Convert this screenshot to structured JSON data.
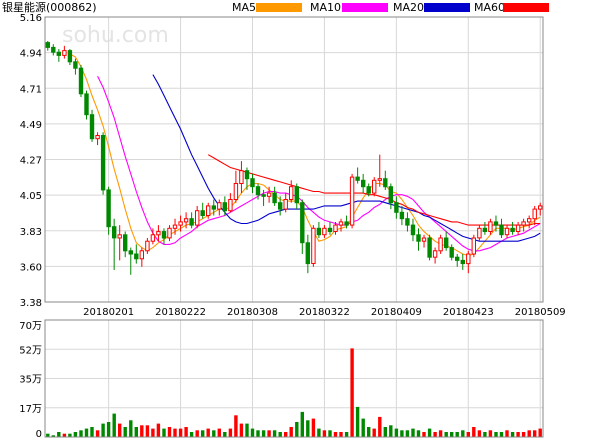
{
  "header": {
    "title": "银星能源(000862)",
    "ma_legend": [
      {
        "label": "MA5",
        "color": "#ff9900"
      },
      {
        "label": "MA10",
        "color": "#ff00ff"
      },
      {
        "label": "MA20",
        "color": "#0000cc"
      },
      {
        "label": "MA60",
        "color": "#ff0000"
      }
    ]
  },
  "watermark": "sohu.com",
  "colors": {
    "up": "#ff0000",
    "down": "#008800",
    "grid": "#d8d8d8",
    "frame": "#888888"
  },
  "chart_data": [
    {
      "type": "candlestick",
      "title": "银星能源(000862)",
      "ylim": [
        3.38,
        5.16
      ],
      "y_ticks": [
        "5.16",
        "4.94",
        "4.71",
        "4.49",
        "4.27",
        "4.05",
        "3.83",
        "3.60",
        "3.38"
      ],
      "x_ticks": [
        "20180201",
        "20180222",
        "20180308",
        "20180322",
        "20180409",
        "20180423",
        "20180509"
      ],
      "x_tick_index": [
        11,
        24,
        37,
        50,
        63,
        76,
        89
      ],
      "ohlc": [
        [
          5.0,
          5.01,
          4.95,
          4.97
        ],
        [
          4.97,
          4.99,
          4.92,
          4.94
        ],
        [
          4.94,
          4.96,
          4.88,
          4.92
        ],
        [
          4.92,
          4.98,
          4.9,
          4.95
        ],
        [
          4.95,
          4.96,
          4.86,
          4.88
        ],
        [
          4.88,
          4.9,
          4.8,
          4.84
        ],
        [
          4.84,
          4.86,
          4.66,
          4.68
        ],
        [
          4.68,
          4.7,
          4.52,
          4.55
        ],
        [
          4.55,
          4.58,
          4.38,
          4.4
        ],
        [
          4.4,
          4.44,
          4.36,
          4.42
        ],
        [
          4.42,
          4.44,
          4.05,
          4.08
        ],
        [
          4.08,
          4.1,
          3.8,
          3.85
        ],
        [
          3.85,
          3.9,
          3.58,
          3.78
        ],
        [
          3.78,
          3.86,
          3.64,
          3.8
        ],
        [
          3.8,
          3.82,
          3.66,
          3.7
        ],
        [
          3.7,
          3.72,
          3.55,
          3.68
        ],
        [
          3.68,
          3.74,
          3.62,
          3.65
        ],
        [
          3.65,
          3.72,
          3.6,
          3.7
        ],
        [
          3.7,
          3.78,
          3.68,
          3.76
        ],
        [
          3.76,
          3.84,
          3.74,
          3.8
        ],
        [
          3.8,
          3.86,
          3.76,
          3.82
        ],
        [
          3.82,
          3.84,
          3.74,
          3.78
        ],
        [
          3.78,
          3.86,
          3.76,
          3.84
        ],
        [
          3.84,
          3.9,
          3.8,
          3.86
        ],
        [
          3.86,
          3.92,
          3.82,
          3.88
        ],
        [
          3.88,
          3.94,
          3.84,
          3.9
        ],
        [
          3.9,
          3.94,
          3.84,
          3.86
        ],
        [
          3.86,
          3.98,
          3.84,
          3.95
        ],
        [
          3.95,
          4.0,
          3.9,
          3.92
        ],
        [
          3.92,
          4.0,
          3.9,
          3.98
        ],
        [
          3.98,
          4.02,
          3.92,
          3.96
        ],
        [
          3.96,
          4.02,
          3.92,
          4.0
        ],
        [
          4.0,
          4.04,
          3.92,
          3.95
        ],
        [
          3.95,
          4.06,
          3.94,
          4.02
        ],
        [
          4.02,
          4.2,
          4.0,
          4.12
        ],
        [
          4.12,
          4.26,
          4.06,
          4.2
        ],
        [
          4.2,
          4.22,
          4.08,
          4.15
        ],
        [
          4.15,
          4.18,
          4.06,
          4.1
        ],
        [
          4.1,
          4.12,
          4.02,
          4.05
        ],
        [
          4.05,
          4.08,
          3.98,
          4.04
        ],
        [
          4.04,
          4.1,
          4.0,
          4.06
        ],
        [
          4.06,
          4.1,
          3.98,
          4.0
        ],
        [
          4.0,
          4.04,
          3.92,
          3.96
        ],
        [
          3.96,
          4.06,
          3.94,
          4.02
        ],
        [
          4.02,
          4.14,
          4.0,
          4.1
        ],
        [
          4.1,
          4.12,
          3.96,
          4.0
        ],
        [
          4.0,
          4.02,
          3.68,
          3.75
        ],
        [
          3.75,
          3.8,
          3.56,
          3.62
        ],
        [
          3.62,
          3.86,
          3.6,
          3.84
        ],
        [
          3.84,
          3.88,
          3.78,
          3.8
        ],
        [
          3.8,
          3.86,
          3.78,
          3.84
        ],
        [
          3.84,
          3.88,
          3.8,
          3.82
        ],
        [
          3.82,
          3.88,
          3.8,
          3.86
        ],
        [
          3.86,
          3.9,
          3.82,
          3.88
        ],
        [
          3.88,
          3.92,
          3.84,
          3.86
        ],
        [
          3.86,
          4.18,
          3.84,
          4.16
        ],
        [
          4.16,
          4.22,
          4.12,
          4.14
        ],
        [
          4.14,
          4.18,
          4.06,
          4.1
        ],
        [
          4.1,
          4.12,
          4.04,
          4.06
        ],
        [
          4.06,
          4.16,
          4.04,
          4.14
        ],
        [
          4.14,
          4.3,
          4.1,
          4.15
        ],
        [
          4.15,
          4.2,
          4.08,
          4.1
        ],
        [
          4.1,
          4.12,
          3.96,
          4.0
        ],
        [
          4.0,
          4.04,
          3.9,
          3.94
        ],
        [
          3.94,
          3.98,
          3.86,
          3.9
        ],
        [
          3.9,
          3.94,
          3.82,
          3.86
        ],
        [
          3.86,
          3.9,
          3.76,
          3.8
        ],
        [
          3.8,
          3.84,
          3.7,
          3.76
        ],
        [
          3.76,
          3.8,
          3.72,
          3.78
        ],
        [
          3.78,
          3.8,
          3.64,
          3.66
        ],
        [
          3.66,
          3.72,
          3.62,
          3.7
        ],
        [
          3.7,
          3.8,
          3.68,
          3.78
        ],
        [
          3.78,
          3.82,
          3.7,
          3.72
        ],
        [
          3.72,
          3.74,
          3.64,
          3.66
        ],
        [
          3.66,
          3.68,
          3.6,
          3.64
        ],
        [
          3.64,
          3.68,
          3.58,
          3.62
        ],
        [
          3.62,
          3.7,
          3.56,
          3.68
        ],
        [
          3.68,
          3.8,
          3.66,
          3.78
        ],
        [
          3.78,
          3.86,
          3.76,
          3.84
        ],
        [
          3.84,
          3.88,
          3.8,
          3.82
        ],
        [
          3.82,
          3.9,
          3.8,
          3.88
        ],
        [
          3.88,
          3.92,
          3.82,
          3.86
        ],
        [
          3.86,
          3.9,
          3.78,
          3.8
        ],
        [
          3.8,
          3.86,
          3.78,
          3.84
        ],
        [
          3.84,
          3.88,
          3.8,
          3.82
        ],
        [
          3.82,
          3.88,
          3.8,
          3.86
        ],
        [
          3.86,
          3.9,
          3.82,
          3.88
        ],
        [
          3.88,
          3.92,
          3.84,
          3.9
        ],
        [
          3.9,
          3.98,
          3.86,
          3.96
        ],
        [
          3.96,
          4.0,
          3.92,
          3.98
        ]
      ],
      "ma": {
        "MA5": [
          null,
          null,
          null,
          null,
          4.93,
          4.91,
          4.85,
          4.77,
          4.67,
          4.58,
          4.48,
          4.35,
          4.21,
          4.09,
          3.96,
          3.84,
          3.75,
          3.72,
          3.7,
          3.72,
          3.75,
          3.77,
          3.8,
          3.82,
          3.84,
          3.86,
          3.87,
          3.88,
          3.9,
          3.92,
          3.94,
          3.96,
          3.96,
          3.97,
          4.01,
          4.06,
          4.1,
          4.12,
          4.12,
          4.11,
          4.08,
          4.05,
          4.02,
          4.01,
          4.01,
          4.01,
          3.97,
          3.89,
          3.82,
          3.76,
          3.77,
          3.79,
          3.83,
          3.84,
          3.85,
          3.91,
          3.97,
          4.03,
          4.08,
          4.12,
          4.12,
          4.11,
          4.07,
          4.06,
          4.02,
          3.97,
          3.92,
          3.86,
          3.82,
          3.79,
          3.76,
          3.74,
          3.73,
          3.72,
          3.7,
          3.68,
          3.67,
          3.68,
          3.72,
          3.76,
          3.8,
          3.84,
          3.84,
          3.84,
          3.83,
          3.84,
          3.85,
          3.86,
          3.89,
          3.91
        ],
        "MA10": [
          null,
          null,
          null,
          null,
          null,
          null,
          null,
          null,
          null,
          4.79,
          4.72,
          4.63,
          4.53,
          4.41,
          4.29,
          4.18,
          4.07,
          3.97,
          3.88,
          3.81,
          3.76,
          3.74,
          3.74,
          3.75,
          3.78,
          3.8,
          3.82,
          3.85,
          3.87,
          3.89,
          3.9,
          3.91,
          3.92,
          3.94,
          3.96,
          3.98,
          4.0,
          4.02,
          4.04,
          4.06,
          4.07,
          4.07,
          4.06,
          4.06,
          4.05,
          4.04,
          4.01,
          3.97,
          3.94,
          3.91,
          3.89,
          3.88,
          3.87,
          3.86,
          3.86,
          3.88,
          3.89,
          3.92,
          3.94,
          3.97,
          3.99,
          4.02,
          4.04,
          4.05,
          4.05,
          4.04,
          4.02,
          3.98,
          3.94,
          3.91,
          3.88,
          3.85,
          3.82,
          3.79,
          3.76,
          3.73,
          3.71,
          3.7,
          3.7,
          3.71,
          3.72,
          3.74,
          3.76,
          3.78,
          3.79,
          3.8,
          3.81,
          3.83,
          3.85,
          3.87
        ],
        "MA20": [
          null,
          null,
          null,
          null,
          null,
          null,
          null,
          null,
          null,
          null,
          null,
          null,
          null,
          null,
          null,
          null,
          null,
          null,
          null,
          4.8,
          4.74,
          4.67,
          4.6,
          4.53,
          4.46,
          4.38,
          4.3,
          4.23,
          4.16,
          4.09,
          4.03,
          3.98,
          3.94,
          3.9,
          3.88,
          3.87,
          3.87,
          3.88,
          3.89,
          3.91,
          3.93,
          3.94,
          3.95,
          3.96,
          3.96,
          3.96,
          3.96,
          3.96,
          3.96,
          3.97,
          3.98,
          3.98,
          3.98,
          3.98,
          3.99,
          4.0,
          4.01,
          4.01,
          4.01,
          4.01,
          4.01,
          4.0,
          3.99,
          3.98,
          3.97,
          3.96,
          3.95,
          3.94,
          3.92,
          3.91,
          3.89,
          3.87,
          3.85,
          3.83,
          3.81,
          3.79,
          3.78,
          3.77,
          3.76,
          3.76,
          3.76,
          3.76,
          3.76,
          3.76,
          3.76,
          3.76,
          3.77,
          3.78,
          3.79,
          3.81
        ],
        "MA60": [
          null,
          null,
          null,
          null,
          null,
          null,
          null,
          null,
          null,
          null,
          null,
          null,
          null,
          null,
          null,
          null,
          null,
          null,
          null,
          null,
          null,
          null,
          null,
          null,
          null,
          null,
          null,
          null,
          null,
          4.3,
          4.28,
          4.26,
          4.24,
          4.22,
          4.21,
          4.2,
          4.19,
          4.18,
          4.17,
          4.16,
          4.15,
          4.14,
          4.13,
          4.12,
          4.11,
          4.1,
          4.09,
          4.08,
          4.07,
          4.07,
          4.06,
          4.06,
          4.06,
          4.06,
          4.06,
          4.06,
          4.06,
          4.06,
          4.05,
          4.05,
          4.04,
          4.03,
          4.02,
          4.0,
          3.99,
          3.97,
          3.96,
          3.94,
          3.93,
          3.92,
          3.91,
          3.9,
          3.89,
          3.88,
          3.88,
          3.87,
          3.86,
          3.86,
          3.86,
          3.86,
          3.86,
          3.86,
          3.86,
          3.86,
          3.86,
          3.86,
          3.86,
          3.86,
          3.87,
          3.87
        ]
      }
    },
    {
      "type": "bar",
      "title": "",
      "ylabel": "",
      "ylim": [
        0,
        70
      ],
      "y_ticks": [
        "70万",
        "52万",
        "35万",
        "17万",
        "0"
      ],
      "values": [
        2,
        1,
        3,
        2,
        2,
        3,
        4,
        5,
        6,
        4,
        8,
        9,
        14,
        8,
        6,
        10,
        6,
        7,
        7,
        5,
        8,
        5,
        6,
        5,
        5,
        6,
        3,
        4,
        4,
        5,
        4,
        5,
        3,
        5,
        13,
        8,
        8,
        5,
        4,
        4,
        4,
        4,
        3,
        3,
        6,
        9,
        15,
        10,
        11,
        5,
        4,
        4,
        3,
        3,
        3,
        53,
        18,
        11,
        6,
        5,
        12,
        6,
        7,
        5,
        4,
        4,
        5,
        4,
        3,
        5,
        3,
        4,
        3,
        3,
        3,
        4,
        3,
        6,
        4,
        3,
        4,
        3,
        3,
        4,
        3,
        3,
        3,
        4,
        4,
        5
      ],
      "up_flags": [
        false,
        false,
        false,
        true,
        false,
        false,
        false,
        false,
        false,
        true,
        false,
        false,
        false,
        true,
        false,
        false,
        false,
        true,
        true,
        true,
        true,
        false,
        true,
        true,
        true,
        true,
        false,
        true,
        false,
        true,
        false,
        true,
        false,
        true,
        true,
        true,
        false,
        false,
        false,
        false,
        true,
        false,
        false,
        true,
        true,
        false,
        false,
        false,
        true,
        false,
        true,
        false,
        true,
        true,
        false,
        true,
        false,
        false,
        false,
        true,
        true,
        false,
        false,
        false,
        false,
        false,
        false,
        false,
        true,
        false,
        true,
        true,
        false,
        false,
        false,
        false,
        true,
        true,
        true,
        false,
        true,
        false,
        false,
        true,
        false,
        true,
        true,
        true,
        true,
        true
      ]
    }
  ]
}
